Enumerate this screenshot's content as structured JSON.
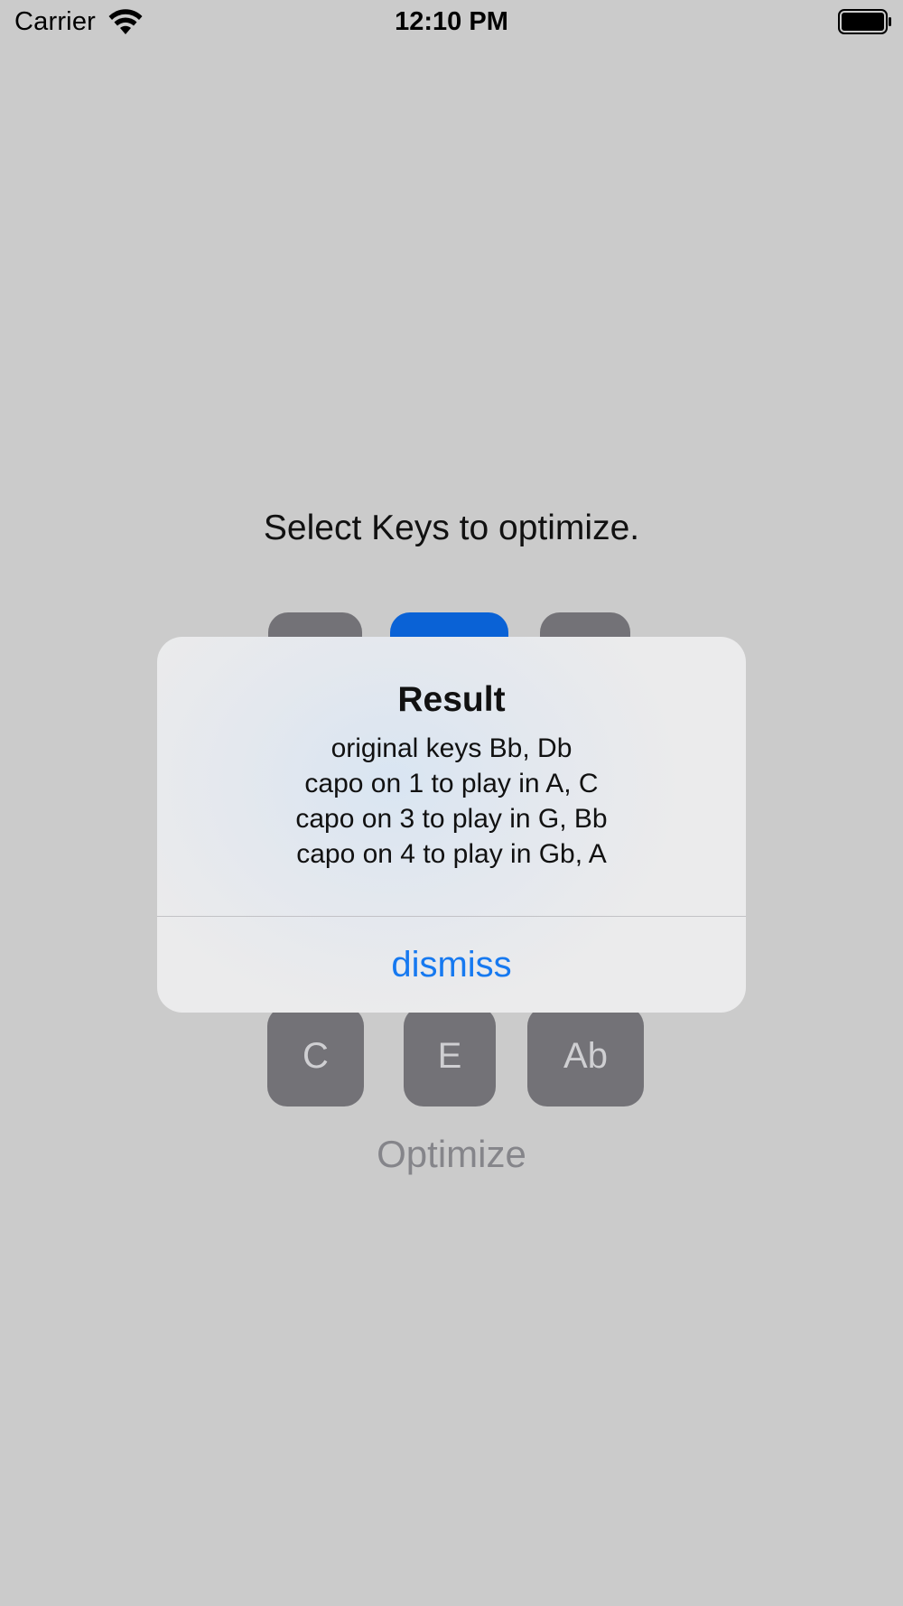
{
  "status_bar": {
    "carrier": "Carrier",
    "time": "12:10 PM",
    "icons": [
      "wifi-icon",
      "battery-icon"
    ]
  },
  "prompt": "Select Keys to optimize.",
  "keys": {
    "top_row": [
      {
        "label": "",
        "selected": false
      },
      {
        "label": "",
        "selected": true
      },
      {
        "label": "",
        "selected": false
      }
    ],
    "bottom_row": [
      {
        "label": "C",
        "selected": false
      },
      {
        "label": "E",
        "selected": false
      },
      {
        "label": "Ab",
        "selected": false
      }
    ]
  },
  "optimize_label": "Optimize",
  "alert": {
    "title": "Result",
    "lines": [
      "original keys Bb, Db",
      "capo on 1 to play in A, C",
      "capo on 3 to play in G, Bb",
      "capo on 4 to play in Gb, A"
    ],
    "dismiss_label": "dismiss"
  },
  "colors": {
    "background": "#cbcbcb",
    "key": "#737277",
    "key_selected": "#0a62d6",
    "link": "#1679f0"
  }
}
